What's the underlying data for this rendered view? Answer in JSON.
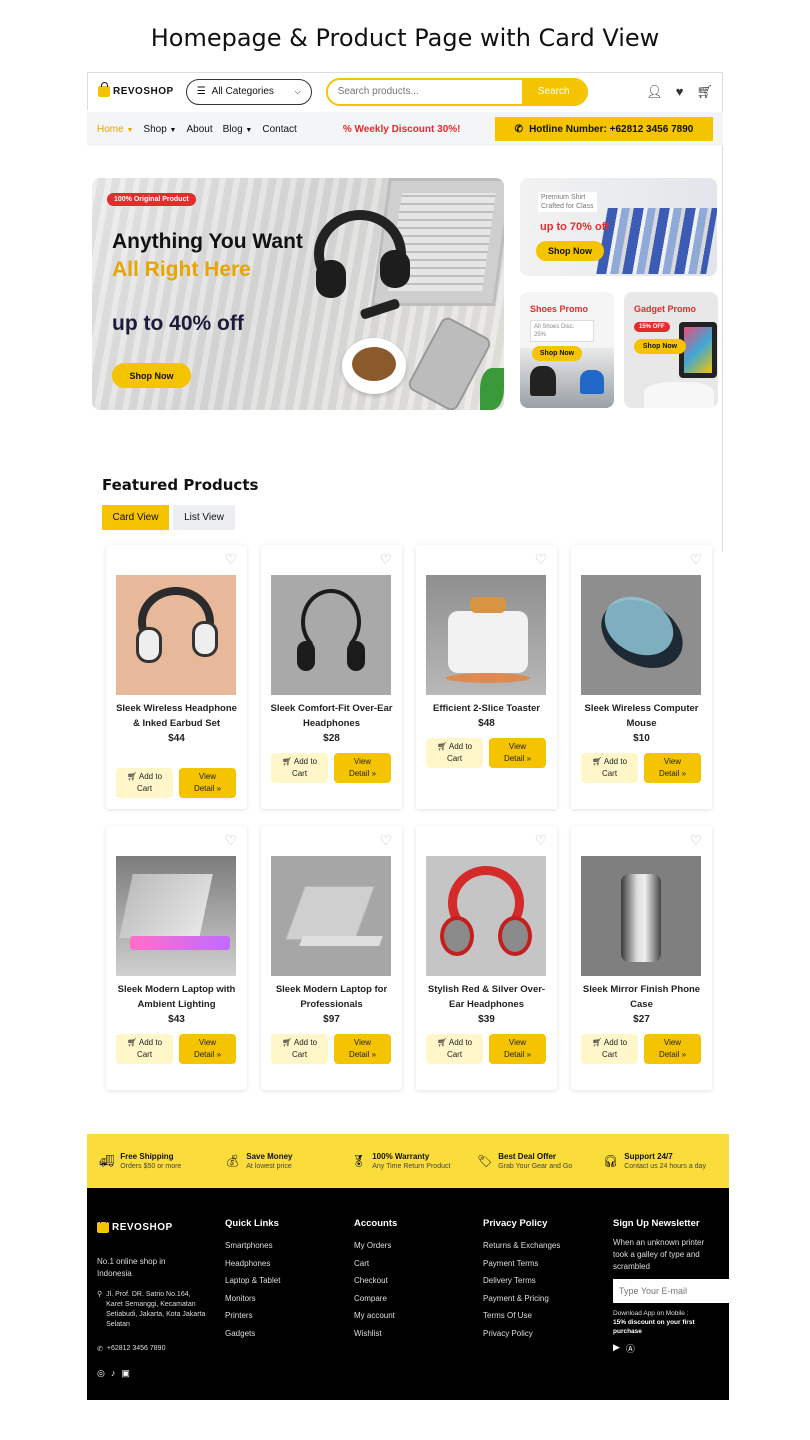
{
  "page_title": "Homepage & Product Page with Card View",
  "header": {
    "logo_text": "REVOSHOP",
    "categories_label": "All Categories",
    "search_placeholder": "Search products...",
    "search_button": "Search"
  },
  "nav": {
    "items": [
      "Home",
      "Shop",
      "About",
      "Blog",
      "Contact"
    ],
    "promo": "Weekly Discount 30%!",
    "hotline": "Hotline Number: +62812 3456 7890"
  },
  "hero": {
    "badge": "100% Original Product",
    "line1": "Anything You Want",
    "line2": "All Right Here",
    "line3": "up to 40% off",
    "button": "Shop Now"
  },
  "promos": {
    "shirt": {
      "label1": "Premium Shirt",
      "label2": "Crafted for Class",
      "offer": "up to 70% off",
      "button": "Shop Now"
    },
    "shoes": {
      "title": "Shoes Promo",
      "line1": "All Shoes Disc.",
      "line2": "25%",
      "button": "Shop Now"
    },
    "gadget": {
      "title": "Gadget Promo",
      "badge": "15% OFF",
      "button": "Shop Now"
    }
  },
  "featured": {
    "title": "Featured Products",
    "card_view": "Card View",
    "list_view": "List View",
    "add_to_cart_1": "Add to",
    "add_to_cart_2": "Cart",
    "view_detail_1": "View",
    "view_detail_2": "Detail »",
    "products": [
      {
        "name": "Sleek Wireless Headphone & Inked Earbud Set",
        "price": "$44"
      },
      {
        "name": "Sleek Comfort-Fit Over-Ear Headphones",
        "price": "$28"
      },
      {
        "name": "Efficient 2-Slice Toaster",
        "price": "$48"
      },
      {
        "name": "Sleek Wireless Computer Mouse",
        "price": "$10"
      },
      {
        "name": "Sleek Modern Laptop with Ambient Lighting",
        "price": "$43"
      },
      {
        "name": "Sleek Modern Laptop for Professionals",
        "price": "$97"
      },
      {
        "name": "Stylish Red & Silver Over-Ear Headphones",
        "price": "$39"
      },
      {
        "name": "Sleek Mirror Finish Phone Case",
        "price": "$27"
      }
    ]
  },
  "features": [
    {
      "title": "Free Shipping",
      "sub": "Orders $50 or more"
    },
    {
      "title": "Save Money",
      "sub": "At lowest price"
    },
    {
      "title": "100% Warranty",
      "sub": "Any Time Return Product"
    },
    {
      "title": "Best Deal Offer",
      "sub": "Grab Your Gear and Go"
    },
    {
      "title": "Support 24/7",
      "sub": "Contact us 24 hours a day"
    }
  ],
  "footer": {
    "logo_text": "REVOSHOP",
    "tagline": "No.1 online shop in Indonesia",
    "address": "Jl. Prof. DR. Satrio No.164, Karet Semanggi, Kecamatan Setiabudi, Jakarta, Kota Jakarta Selatan",
    "phone": "+62812 3456 7890",
    "quick_links": {
      "title": "Quick Links",
      "items": [
        "Smartphones",
        "Headphones",
        "Laptop & Tablet",
        "Monitors",
        "Printers",
        "Gadgets"
      ]
    },
    "accounts": {
      "title": "Accounts",
      "items": [
        "My Orders",
        "Cart",
        "Checkout",
        "Compare",
        "My account",
        "Wishlist"
      ]
    },
    "privacy": {
      "title": "Privacy Policy",
      "items": [
        "Returns & Exchanges",
        "Payment Terms",
        "Delivery Terms",
        "Payment & Pricing",
        "Terms Of Use",
        "Privacy Policy"
      ]
    },
    "newsletter": {
      "title": "Sign Up Newsletter",
      "text": "When an unknown printer took a galley of type and scrambled",
      "placeholder": "Type Your E-mail",
      "app_text": "Download App on Mobile :",
      "app_bold": "15% discount on your first purchase"
    }
  },
  "colors": {
    "accent": "#f5c400",
    "danger": "#e52b2b",
    "footer_bg": "#000000",
    "features_bg": "#fadc3b"
  }
}
